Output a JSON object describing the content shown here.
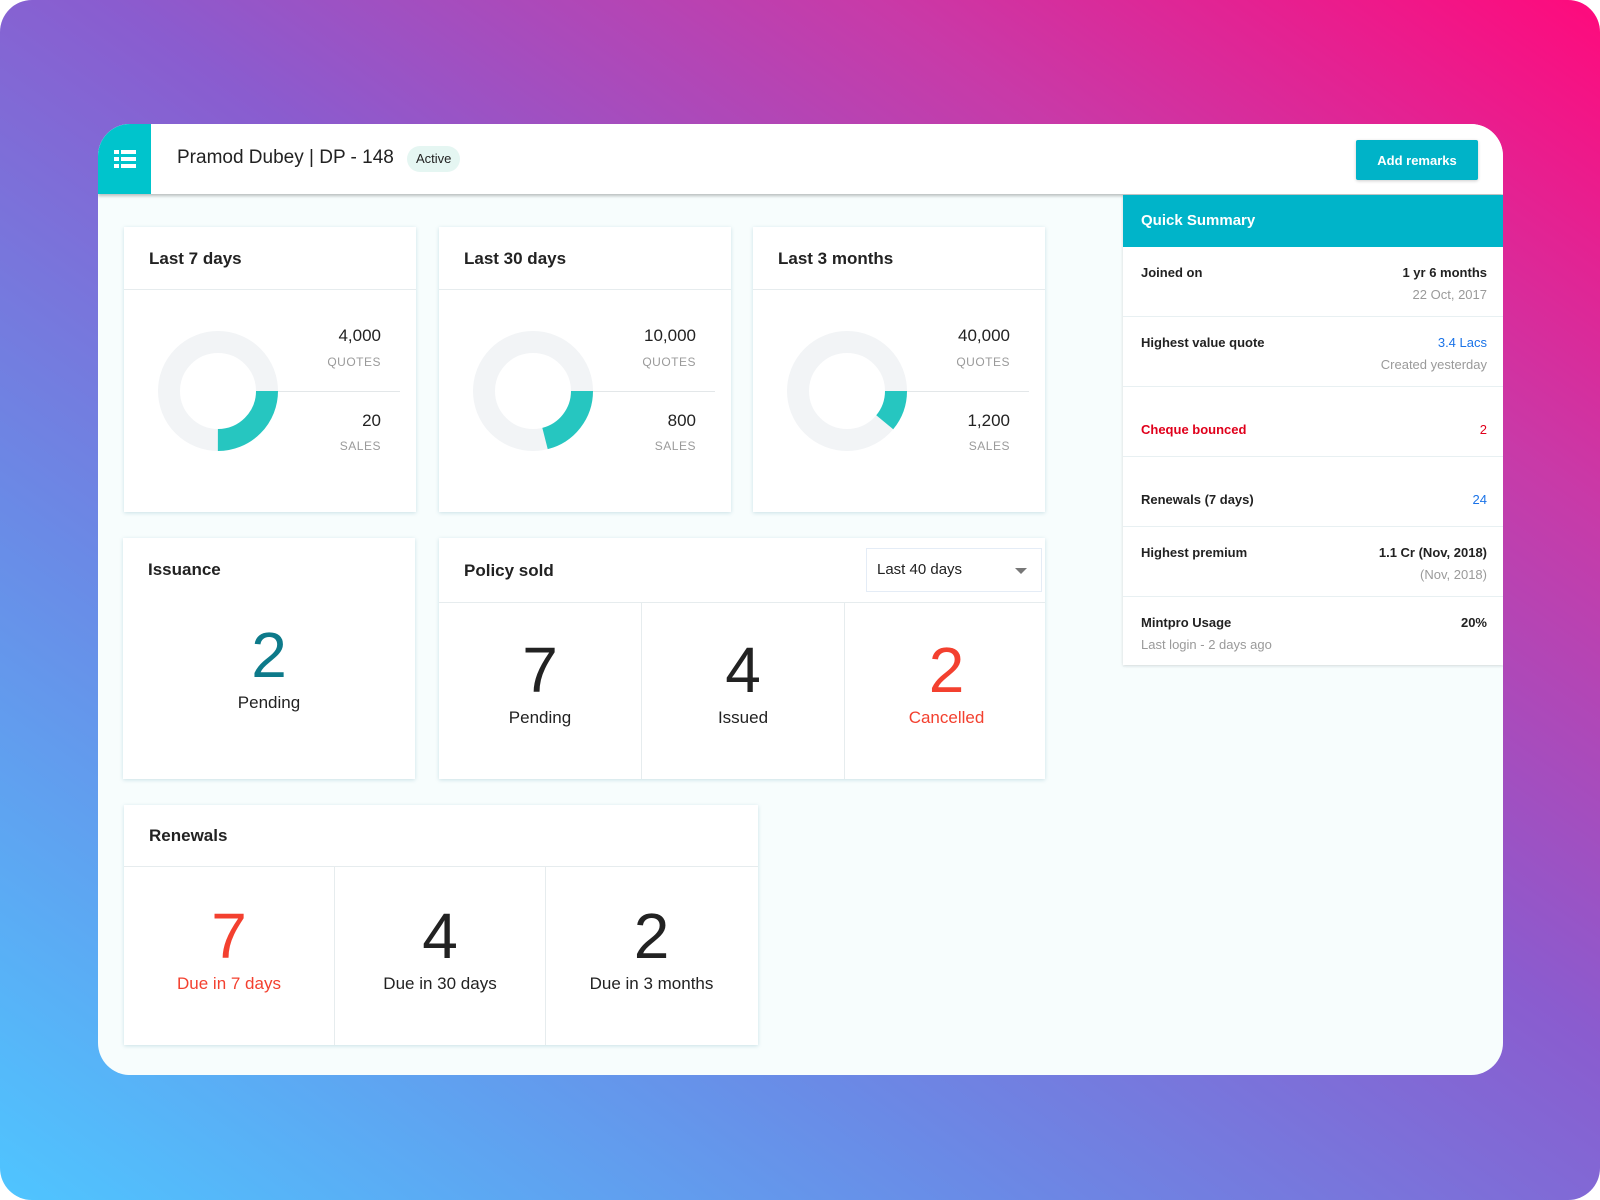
{
  "header": {
    "title": "Pramod Dubey | DP - 148",
    "status": "Active",
    "add_remarks": "Add remarks",
    "menu_icon": "list-icon"
  },
  "period_cards": [
    {
      "title": "Last 7 days",
      "quotes": "4,000",
      "quotes_label": "QUOTES",
      "sales": "20",
      "sales_label": "SALES",
      "arc_fraction": 0.25
    },
    {
      "title": "Last 30 days",
      "quotes": "10,000",
      "quotes_label": "QUOTES",
      "sales": "800",
      "sales_label": "SALES",
      "arc_fraction": 0.21
    },
    {
      "title": "Last 3 months",
      "quotes": "40,000",
      "quotes_label": "QUOTES",
      "sales": "1,200",
      "sales_label": "SALES",
      "arc_fraction": 0.11
    }
  ],
  "issuance": {
    "title": "Issuance",
    "value": "2",
    "label": "Pending"
  },
  "policy_sold": {
    "title": "Policy sold",
    "filter": "Last 40 days",
    "stats": [
      {
        "value": "7",
        "label": "Pending"
      },
      {
        "value": "4",
        "label": "Issued"
      },
      {
        "value": "2",
        "label": "Cancelled"
      }
    ]
  },
  "renewals": {
    "title": "Renewals",
    "stats": [
      {
        "value": "7",
        "label": "Due in 7 days"
      },
      {
        "value": "4",
        "label": "Due in 30 days"
      },
      {
        "value": "2",
        "label": "Due in 3 months"
      }
    ]
  },
  "quick_summary": {
    "title": "Quick Summary",
    "rows": [
      {
        "label": "Joined on",
        "value": "1 yr 6 months",
        "sub": "22 Oct, 2017"
      },
      {
        "label": "Highest value quote",
        "value": "3.4 Lacs",
        "sub": "Created yesterday"
      },
      {
        "label": "Cheque bounced",
        "value": "2"
      },
      {
        "label": "Renewals (7 days)",
        "value": "24"
      },
      {
        "label": "Highest premium",
        "value": "1.1 Cr (Nov, 2018)",
        "sub": "(Nov, 2018)"
      },
      {
        "label": "Mintpro Usage",
        "value": "20%",
        "sub": "Last login - 2 days ago"
      }
    ]
  },
  "colors": {
    "accent": "#00b4c9",
    "donut": "#26c6c0",
    "danger": "#f3402f",
    "link": "#1a73e8",
    "alert": "#e0001b"
  }
}
